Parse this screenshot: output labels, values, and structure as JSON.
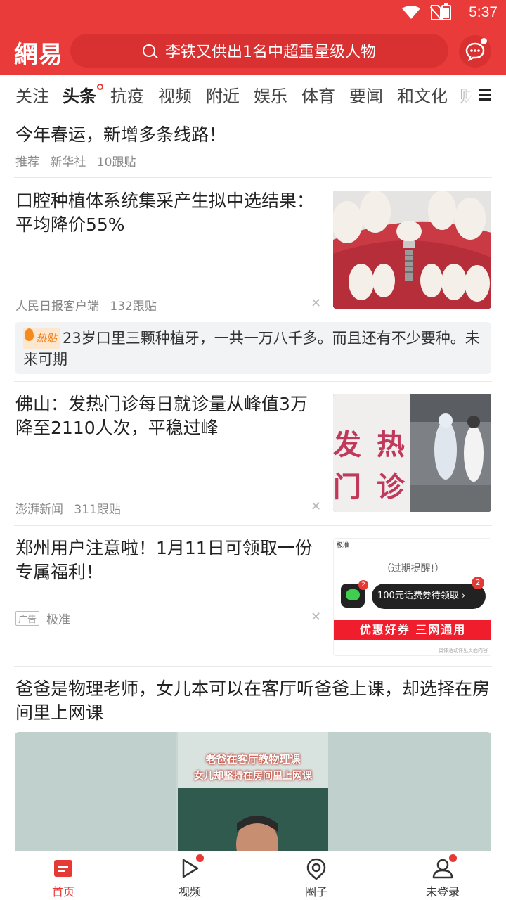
{
  "status_bar": {
    "time": "5:37"
  },
  "header": {
    "logo": "網易",
    "search_placeholder": "李铁又供出1名中超重量级人物"
  },
  "tabs": [
    {
      "label": "关注"
    },
    {
      "label": "头条",
      "active": true
    },
    {
      "label": "抗疫"
    },
    {
      "label": "视频"
    },
    {
      "label": "附近"
    },
    {
      "label": "娱乐"
    },
    {
      "label": "体育"
    },
    {
      "label": "要闻"
    },
    {
      "label": "和文化"
    },
    {
      "label": "财"
    }
  ],
  "feed": {
    "item1": {
      "title": "今年春运，新增多条线路！",
      "tag": "推荐",
      "source": "新华社",
      "comments": "10跟贴"
    },
    "item2": {
      "title": "口腔种植体系统集采产生拟中选结果：平均降价55%",
      "source": "人民日报客户端",
      "comments": "132跟贴",
      "hot_label": "热贴",
      "hot_comment": "23岁口里三颗种植牙，一共一万八千多。而且还有不少要种。未来可期"
    },
    "item3": {
      "title": "佛山：发热门诊每日就诊量从峰值3万降至2110人次，平稳过峰",
      "source": "澎湃新闻",
      "comments": "311跟贴",
      "image_text_1": "发 热",
      "image_text_2": "门 诊"
    },
    "item4": {
      "title": "郑州用户注意啦！1月11日可领取一份专属福利！",
      "ad_label": "广告",
      "source": "极准",
      "ad_img": {
        "top": "极准",
        "reminder": "（过期提醒!）",
        "badge": "2",
        "pill": "100元话费券待领取",
        "banner": "优惠好券 三网通用",
        "fine": "具体活动详见页面内容"
      }
    },
    "item5": {
      "title": "爸爸是物理老师，女儿本可以在客厅听爸爸上课，却选择在房间里上网课",
      "video_caption_1": "老爸在客厅教物理课",
      "video_caption_2": "女儿却坚持在房间里上网课"
    }
  },
  "bottom_nav": [
    {
      "label": "首页",
      "active": true
    },
    {
      "label": "视频",
      "badge": true
    },
    {
      "label": "圈子"
    },
    {
      "label": "未登录",
      "badge": true
    }
  ],
  "colors": {
    "brand_red": "#ea3b3b",
    "hot_orange": "#f07a12"
  }
}
